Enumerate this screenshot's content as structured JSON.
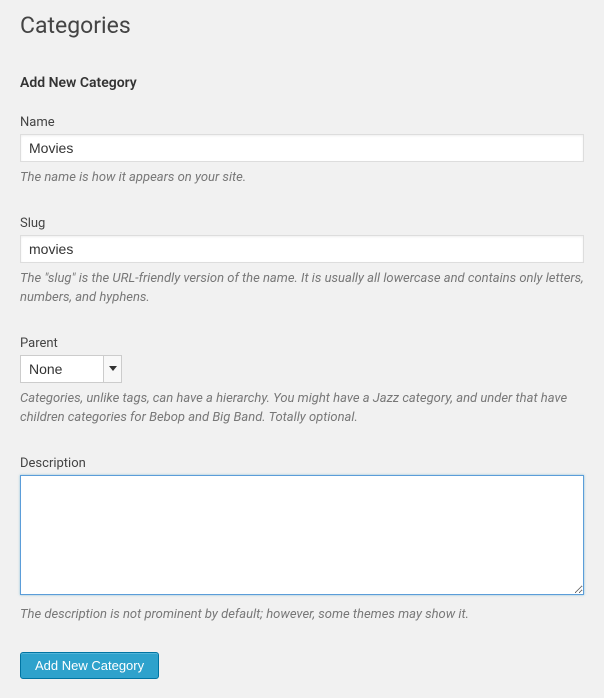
{
  "page": {
    "title": "Categories"
  },
  "form": {
    "heading": "Add New Category",
    "name": {
      "label": "Name",
      "value": "Movies",
      "help": "The name is how it appears on your site."
    },
    "slug": {
      "label": "Slug",
      "value": "movies",
      "help": "The \"slug\" is the URL-friendly version of the name. It is usually all lowercase and contains only letters, numbers, and hyphens."
    },
    "parent": {
      "label": "Parent",
      "selected": "None",
      "help": "Categories, unlike tags, can have a hierarchy. You might have a Jazz category, and under that have children categories for Bebop and Big Band. Totally optional."
    },
    "description": {
      "label": "Description",
      "value": "",
      "help": "The description is not prominent by default; however, some themes may show it."
    },
    "submit": {
      "label": "Add New Category"
    }
  }
}
